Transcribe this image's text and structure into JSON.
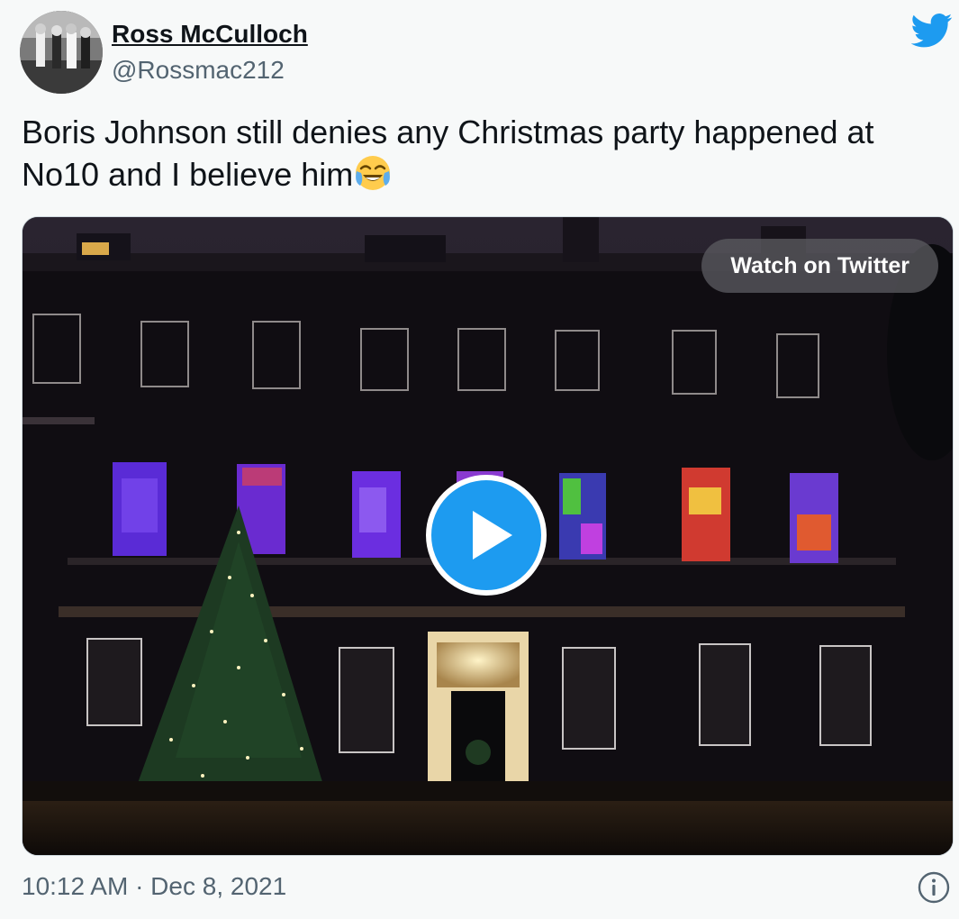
{
  "user": {
    "display_name": "Ross McCulloch",
    "handle": "@Rossmac212"
  },
  "tweet": {
    "text": "Boris Johnson still denies any Christmas party happened at No10 and I believe him",
    "emoji": "face-with-tears-of-joy-icon"
  },
  "media": {
    "watch_label": "Watch on Twitter",
    "play_icon": "play-icon"
  },
  "footer": {
    "timestamp": "10:12 AM · Dec 8, 2021",
    "info_icon": "info-icon"
  },
  "colors": {
    "twitter_blue": "#1d9bf0",
    "text_primary": "#0f1419",
    "text_secondary": "#536471",
    "background": "#f7f9f9"
  }
}
